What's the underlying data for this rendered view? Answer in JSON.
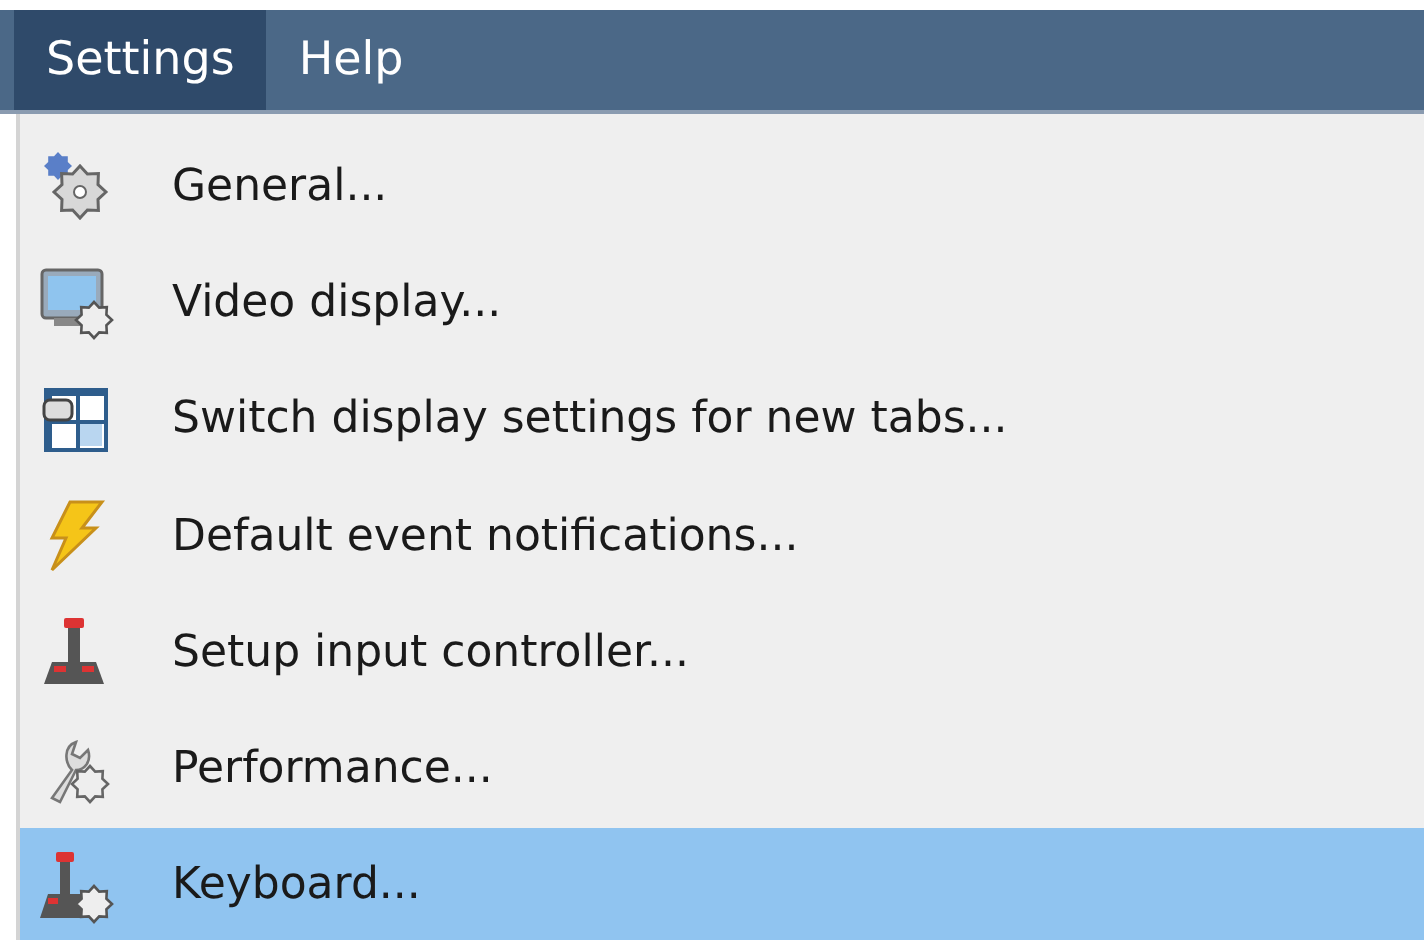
{
  "menubar": [
    {
      "label": "Settings",
      "selected": true
    },
    {
      "label": "Help",
      "selected": false
    }
  ],
  "menu": {
    "items": [
      {
        "kind": "gear",
        "label": "General...",
        "selected": false
      },
      {
        "kind": "monitor",
        "label": "Video display...",
        "selected": false
      },
      {
        "kind": "grid",
        "label": "Switch display settings for new tabs...",
        "selected": false
      },
      {
        "kind": "bolt",
        "label": "Default event notifications...",
        "selected": false
      },
      {
        "kind": "joystick",
        "label": "Setup input controller...",
        "selected": false
      },
      {
        "kind": "tools",
        "label": "Performance...",
        "selected": false
      },
      {
        "kind": "joystick-gear",
        "label": "Keyboard...",
        "selected": true
      }
    ]
  }
}
